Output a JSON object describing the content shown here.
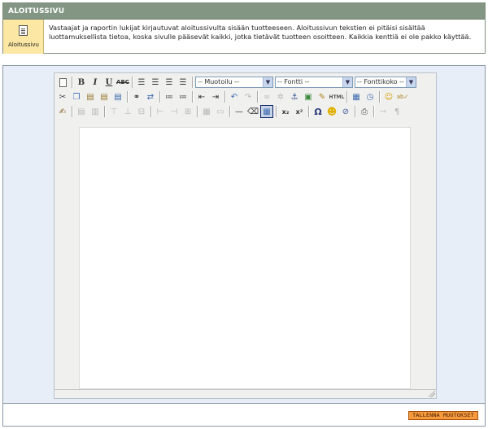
{
  "header": {
    "title": "ALOITUSSIVU",
    "tile_label": "Aloitussivu",
    "description": "Vastaajat ja raportin lukijat kirjautuvat aloitussivulta sisään tuotteeseen. Aloitussivun tekstien ei pitäisi sisältää luottamuksellista tietoa, koska sivulle pääsevät kaikki, jotka tietävät tuotteen osoitteen. Kaikkia kenttiä ei ole pakko käyttää."
  },
  "toolbar": {
    "format_select": "-- Muotoilu --",
    "font_select": "-- Fontti --",
    "size_select": "-- Fonttikoko --",
    "bold": "B",
    "italic": "I",
    "underline": "U",
    "strike": "ABC",
    "html_label": "HTML",
    "omega": "Ω",
    "subscript": "x₂",
    "superscript": "x²"
  },
  "footer": {
    "save_label": "TALLENNA MUUTOKSET"
  },
  "colors": {
    "header_bar": "#839683",
    "tile_bg": "#fce7a4",
    "editor_bg": "#e8eef8",
    "save_button": "#f79a3d"
  }
}
